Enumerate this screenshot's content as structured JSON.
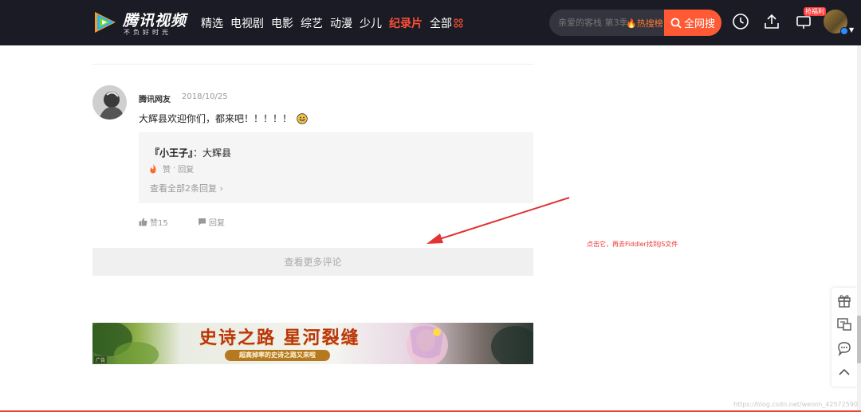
{
  "brand": {
    "name": "腾讯视频",
    "slogan": "不负好时光"
  },
  "nav": {
    "items": [
      {
        "label": "精选",
        "active": false
      },
      {
        "label": "电视剧",
        "active": false
      },
      {
        "label": "电影",
        "active": false
      },
      {
        "label": "综艺",
        "active": false
      },
      {
        "label": "动漫",
        "active": false
      },
      {
        "label": "少儿",
        "active": false
      },
      {
        "label": "纪录片",
        "active": true
      },
      {
        "label": "全部",
        "active": false
      }
    ]
  },
  "search": {
    "placeholder": "亲爱的客栈 第3季",
    "hot_rank_label": "热搜榜",
    "button_label": "全网搜"
  },
  "header": {
    "badge": "抢福利"
  },
  "comment": {
    "username": "腾讯网友",
    "date": "2018/10/25",
    "text": "大辉县欢迎你们，都来吧！！！！！",
    "reply": {
      "user": "『小王子』",
      "separator": "：",
      "text": "大辉县",
      "like_label": "赞",
      "dot": "·",
      "reply_label": "回复",
      "view_all": "查看全部2条回复"
    },
    "like_label": "赞15",
    "reply_label": "回复"
  },
  "more_comments": "查看更多评论",
  "annotation": "点击它，再去Fiddler找到JS文件",
  "banner": {
    "title": "史诗之路 星河裂缝",
    "subtitle": "超高掉率的史诗之路又来啦",
    "ad_tag": "广告"
  },
  "watermark": "https://blog.csdn.net/weixin_42572590",
  "colors": {
    "accent": "#ff5a34",
    "active_nav": "#ff4f36",
    "annotation": "#e33333"
  }
}
